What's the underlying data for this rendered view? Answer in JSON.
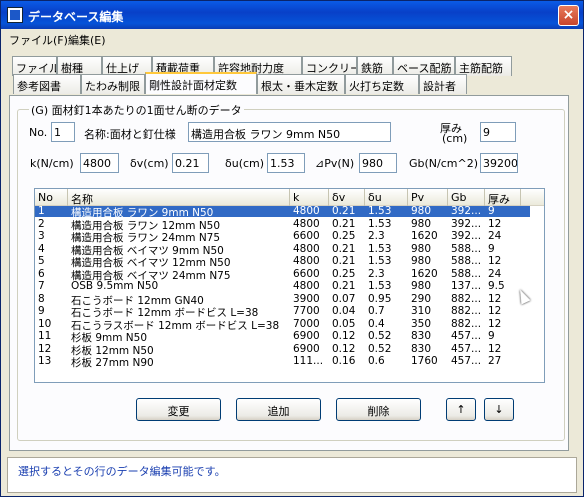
{
  "window": {
    "title": "データベース編集",
    "close": "×"
  },
  "menu": [
    "ファイル(F)",
    "編集(E)"
  ],
  "tabs_row1": [
    "ファイル",
    "樹種",
    "仕上げ",
    "積載荷重",
    "許容地耐力度",
    "コンクリート",
    "鉄筋",
    "ベース配筋",
    "主筋配筋"
  ],
  "tabs_row2": [
    "参考図書",
    "たわみ制限",
    "剛性設計面材定数",
    "根太・垂木定数",
    "火打ち定数",
    "設計者"
  ],
  "group": {
    "title": "(G) 面材釘1本あたりの1面せん断のデータ"
  },
  "form": {
    "no_label": "No.",
    "no_value": "1",
    "name_label": "名称:面材と釘仕様",
    "name_value": "構造用合板 ラワン 9mm     N50",
    "thick_label_1": "厚み",
    "thick_label_2": "(cm)",
    "thick_value": "9",
    "k_label": "k(N/cm)",
    "k_value": "4800",
    "dv_label": "δv(cm)",
    "dv_value": "0.21",
    "du_label": "δu(cm)",
    "du_value": "1.53",
    "pv_label": "⊿Pv(N)",
    "pv_value": "980",
    "gb_label": "Gb(N/cm^2)",
    "gb_value": "39200"
  },
  "table": {
    "columns": [
      "No",
      "名称",
      "k",
      "δv",
      "δu",
      "Pv",
      "Gb",
      "厚み"
    ],
    "rows": [
      [
        "1",
        "構造用合板 ラワン 9mm     N50",
        "4800",
        "0.21",
        "1.53",
        "980",
        "392...",
        "9"
      ],
      [
        "2",
        "構造用合板 ラワン 12mm     N50",
        "4800",
        "0.21",
        "1.53",
        "980",
        "392...",
        "12"
      ],
      [
        "3",
        "構造用合板 ラワン 24mm     N75",
        "6600",
        "0.25",
        "2.3",
        "1620",
        "392...",
        "24"
      ],
      [
        "4",
        "構造用合板 ベイマツ 9mm  N50",
        "4800",
        "0.21",
        "1.53",
        "980",
        "588...",
        "9"
      ],
      [
        "5",
        "構造用合板 ベイマツ 12mm  N50",
        "4800",
        "0.21",
        "1.53",
        "980",
        "588...",
        "12"
      ],
      [
        "6",
        "構造用合板 ベイマツ 24mm  N75",
        "6600",
        "0.25",
        "2.3",
        "1620",
        "588...",
        "24"
      ],
      [
        "7",
        "OSB 9.5mm     N50",
        "4800",
        "0.21",
        "1.53",
        "980",
        "137...",
        "9.5"
      ],
      [
        "8",
        "石こうボード 12mm GN40",
        "3900",
        "0.07",
        "0.95",
        "290",
        "882...",
        "12"
      ],
      [
        "9",
        "石こうボード 12mm ボードビス L=38",
        "7700",
        "0.04",
        "0.7",
        "310",
        "882...",
        "12"
      ],
      [
        "10",
        "石こうラスボード 12mm ボードビス L=38",
        "7000",
        "0.05",
        "0.4",
        "350",
        "882...",
        "12"
      ],
      [
        "11",
        "杉板  9mm N50",
        "6900",
        "0.12",
        "0.52",
        "830",
        "457...",
        "9"
      ],
      [
        "12",
        "杉板 12mm N50",
        "6900",
        "0.12",
        "0.52",
        "830",
        "457...",
        "12"
      ],
      [
        "13",
        "杉板 27mm N90",
        "111...",
        "0.16",
        "0.6",
        "1760",
        "457...",
        "27"
      ]
    ]
  },
  "buttons": {
    "change": "変更",
    "add": "追加",
    "delete": "削除",
    "up": "↑",
    "down": "↓"
  },
  "status": "選択するとその行のデータ編集可能です。",
  "colors": {
    "titlebar": "#0a5be6",
    "selection": "#316ac5",
    "status_text": "#1a3fb0"
  }
}
